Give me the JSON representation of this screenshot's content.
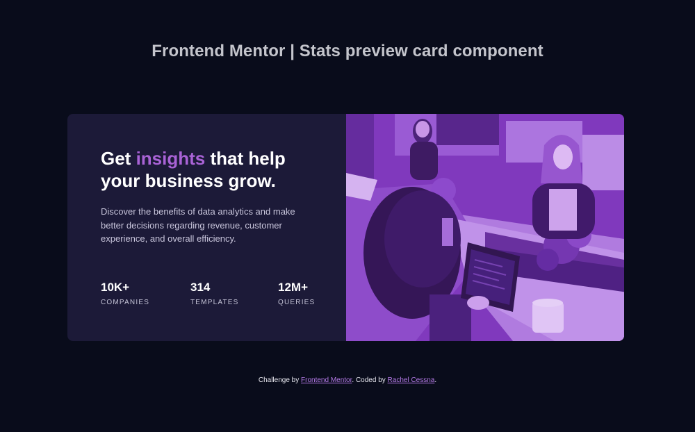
{
  "page": {
    "title": "Frontend Mentor | Stats preview card component"
  },
  "card": {
    "heading_pre": "Get ",
    "heading_accent": "insights",
    "heading_post": " that help your business grow.",
    "description": "Discover the benefits of data analytics and make better decisions regarding revenue, customer experience, and overall efficiency.",
    "stats": [
      {
        "value": "10K+",
        "label": "COMPANIES"
      },
      {
        "value": "314",
        "label": "TEMPLATES"
      },
      {
        "value": "12M+",
        "label": "QUERIES"
      }
    ],
    "image_icon": "office-photo"
  },
  "footer": {
    "prefix": "Challenge by ",
    "challenge_link": "Frontend Mentor",
    "middle": ". Coded by ",
    "author_link": "Rachel Cessna",
    "suffix": "."
  },
  "colors": {
    "background": "#090c1b",
    "card": "#1c1a38",
    "accent": "#a963d6",
    "image_tint": "#7b33b5"
  }
}
